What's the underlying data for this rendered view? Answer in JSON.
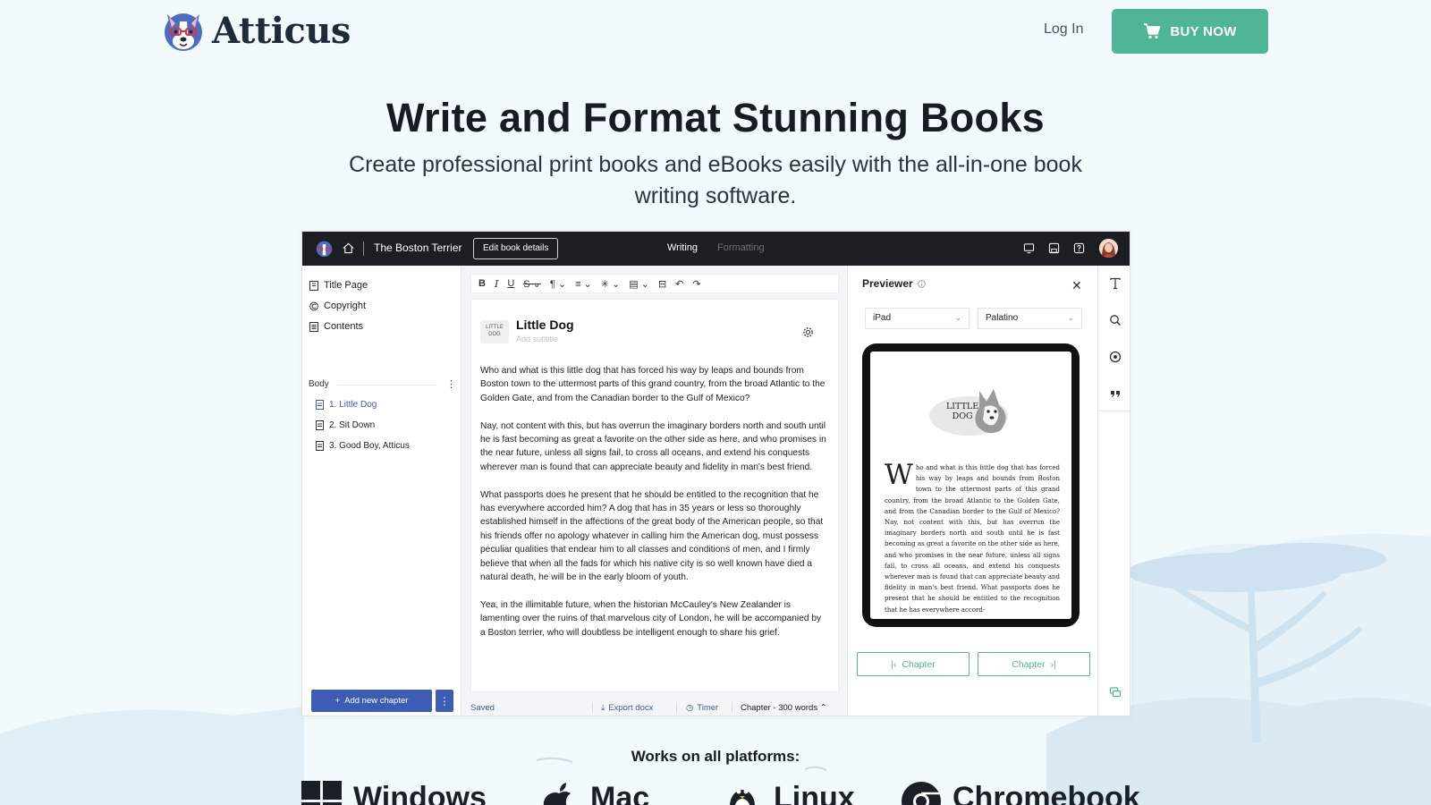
{
  "header": {
    "brand": "Atticus",
    "login_label": "Log In",
    "buy_label": "BUY NOW",
    "buy_color": "#4fb595"
  },
  "hero": {
    "title": "Write and Format Stunning Books",
    "subtitle": "Create professional print books and eBooks easily with the all-in-one book writing software."
  },
  "app": {
    "book_title": "The Boston Terrier",
    "edit_button": "Edit book details",
    "tabs": {
      "writing": "Writing",
      "formatting": "Formatting"
    },
    "sidebar": {
      "items": [
        "Title Page",
        "Copyright",
        "Contents"
      ],
      "body_label": "Body",
      "chapters": [
        "1. Little Dog",
        "2. Sit Down",
        "3. Good Boy, Atticus"
      ],
      "add_chapter": "Add new chapter"
    },
    "editor": {
      "chapter_logo": "LITTLE DOG",
      "chapter_title": "Little Dog",
      "subtitle_placeholder": "Add subtitle",
      "paragraphs": [
        "Who and what is this little dog that has forced his way by leaps and bounds from Boston town to the uttermost parts of this grand country, from the broad Atlantic to the Golden Gate, and from the Canadian border to the Gulf of Mexico?",
        "Nay, not content with this, but has overrun the imaginary borders north and south until he is fast becoming as great a favorite on the other side as here, and who promises in the near future, unless all signs fail, to cross all oceans, and extend his conquests wherever man is found that can appreciate beauty and fidelity in man's best friend.",
        "What passports does he present that he should be entitled to the recognition that he has everywhere accorded him? A dog that has in 35 years or less so thoroughly established himself in the affections of the great body of the American people, so that his friends offer no apology whatever in calling him the American dog, must possess peculiar qualities that endear him to all classes and conditions of men, and I firmly believe that when all the fads for which his native city is so well known have died a natural death, he will be in the early bloom of youth.",
        " Yea, in the illimitable future, when the historian McCauley's New Zealander is lamenting over the ruins of that marvelous city of London, he will be accompanied by a Boston terrier, who will doubtless be intelligent enough to share his grief."
      ],
      "status": {
        "saved": "Saved",
        "export": "Export docx",
        "timer": "Timer",
        "word_count": "Chapter - 300 words"
      }
    },
    "previewer": {
      "title": "Previewer",
      "device": "iPad",
      "font": "Palatino",
      "chapter_heading_line1": "LITTLE",
      "chapter_heading_line2": "DOG",
      "dropcap": "W",
      "preview_text": "ho and what is this little dog that has forced his way by leaps and bounds from Boston town to the uttermost parts of this grand country, from the broad Atlantic to the Golden Gate, and from the Canadian border to the Gulf of Mexico? Nay, not content with this, but has overrun the imaginary borders north and south until he is fast becoming as great a favorite on the other side as here, and who promises in the near future, unless all signs fail, to cross all oceans, and extend his conquests wherever man is found that can appreciate beauty and fidelity in man's best friend. What passports does he present that he should be entitled to the recognition that he has everywhere accord-",
      "prev_chapter": "Chapter",
      "next_chapter": "Chapter"
    }
  },
  "platforms": {
    "title": "Works on all platforms:",
    "items": [
      "Windows",
      "Mac",
      "Linux",
      "Chromebook"
    ]
  }
}
